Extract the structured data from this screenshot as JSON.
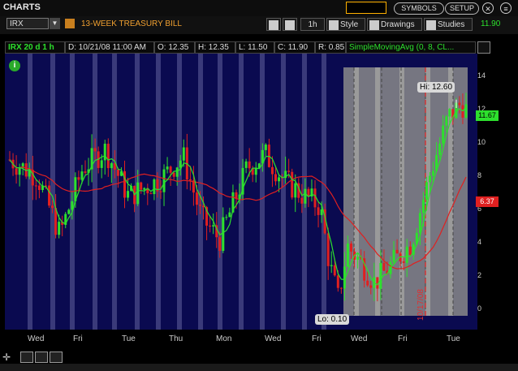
{
  "window": {
    "title": "CHARTS"
  },
  "header_buttons": {
    "symbols": "SYMBOLS",
    "setup": "SETUP"
  },
  "toolbar": {
    "symbol": "IRX",
    "chart_name": "13-WEEK TREASURY BILL",
    "timeframe": "1h",
    "style": "Style",
    "drawings": "Drawings",
    "studies": "Studies",
    "last_price": "11.90"
  },
  "infobar": {
    "symbol_period": "IRX 20 d 1 h",
    "date": "D: 10/21/08 11:00 AM",
    "open": "O: 12.35",
    "high": "H: 12.35",
    "low": "L: 11.50",
    "close": "C: 11.90",
    "range": "R: 0.85",
    "study": "SimpleMovingAvg (0, 8, CL..."
  },
  "annotations": {
    "hi": "Hi: 12.60",
    "lo": "Lo: 0.10",
    "date_marker": "10/17/08"
  },
  "badges": {
    "sma_fast": "11.67",
    "sma_slow": "6.37"
  },
  "chart_data": {
    "type": "candlestick",
    "y_ticks": [
      "14",
      "12",
      "10",
      "8",
      "6",
      "4",
      "2",
      "0"
    ],
    "x_ticks": [
      "Wed",
      "Fri",
      "Tue",
      "Thu",
      "Mon",
      "Wed",
      "Fri",
      "Wed",
      "Fri",
      "Tue"
    ],
    "ylim": [
      -1,
      15
    ],
    "hi": 12.6,
    "lo": 0.1,
    "current_price": 11.9,
    "series": [
      {
        "name": "SimpleMovingAvg (0, 8, CL...",
        "last": 11.67
      },
      {
        "name": "",
        "last": 6.37
      }
    ]
  },
  "colors": {
    "background": "#0a0a50",
    "up": "#2de02d",
    "down": "#e02020",
    "sma_fast": "#2de02d",
    "sma_slow": "#e02020",
    "highlight": "#ffffff"
  },
  "bottom_icons": [
    "zoom-in-icon",
    "zoom-out-icon",
    "fit-icon"
  ]
}
